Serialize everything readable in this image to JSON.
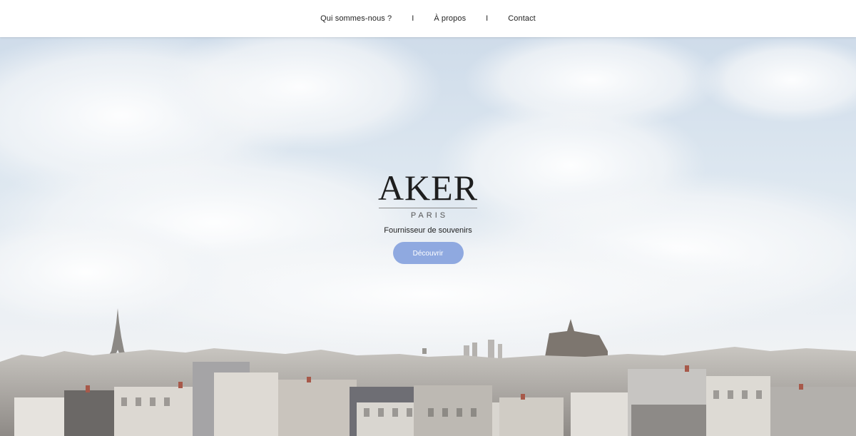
{
  "nav": {
    "items": [
      {
        "label": "Qui sommes-nous ?"
      },
      {
        "label": "À propos"
      },
      {
        "label": "Contact"
      }
    ],
    "separator": "I"
  },
  "hero": {
    "brand_name": "AKER",
    "brand_city": "PARIS",
    "tagline": "Fournisseur de souvenirs",
    "cta_label": "Découvrir"
  },
  "colors": {
    "accent": "#8fa9e0",
    "nav_background": "#ffffff",
    "text": "#222222"
  }
}
